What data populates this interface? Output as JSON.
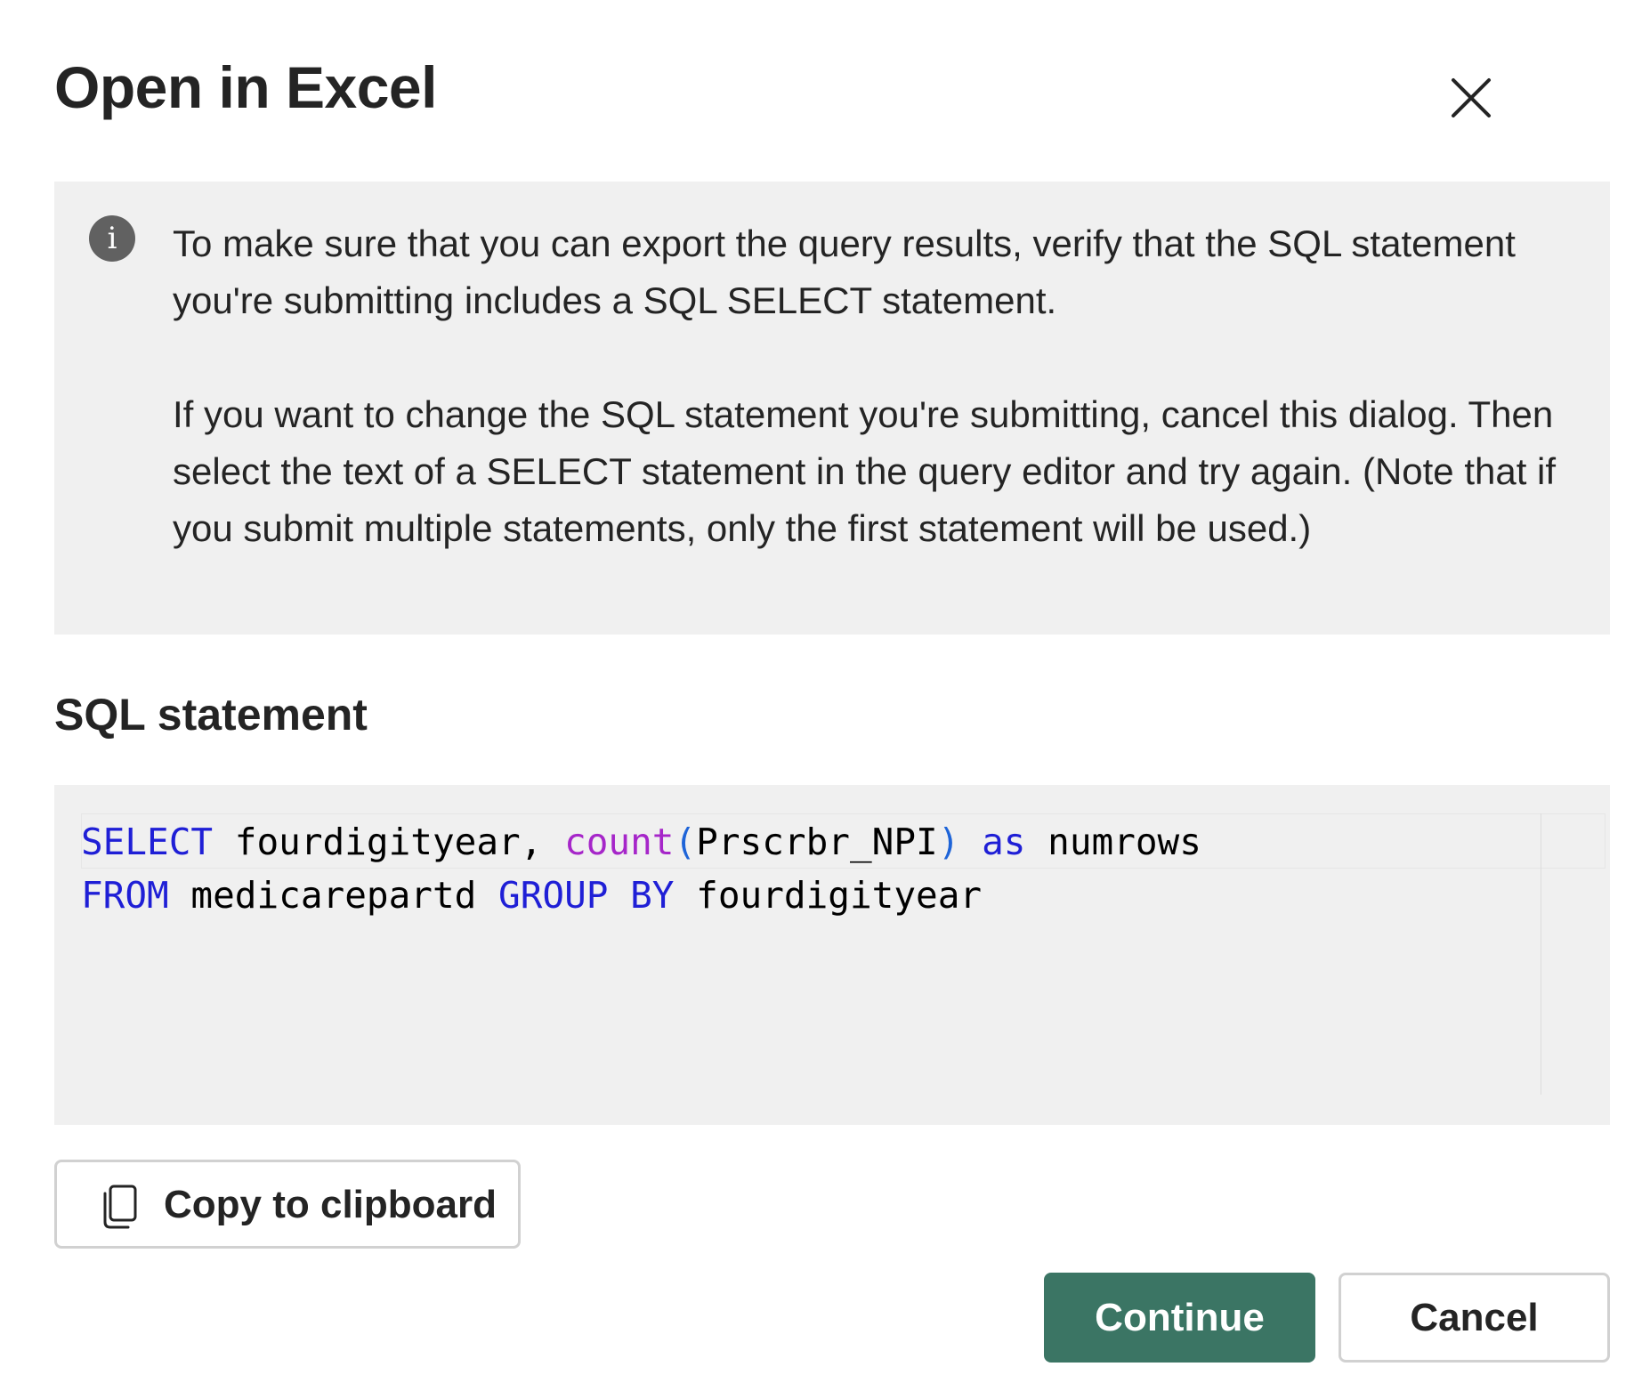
{
  "dialog": {
    "title": "Open in Excel",
    "close_icon": "close-icon"
  },
  "info": {
    "icon": "info-icon",
    "icon_glyph": "i",
    "paragraph1": "To make sure that you can export the query results, verify that the SQL statement you're submitting includes a SQL SELECT statement.",
    "paragraph2": "If you want to change the SQL statement you're submitting, cancel this dialog. Then select the text of a SELECT statement in the query editor and try again. (Note that if you submit multiple statements, only the first statement will be used.)"
  },
  "sql_section": {
    "heading": "SQL statement",
    "code_lines": [
      [
        {
          "text": "SELECT",
          "kind": "kw"
        },
        {
          "text": " fourdigityear, ",
          "kind": "plain"
        },
        {
          "text": "count",
          "kind": "fn"
        },
        {
          "text": "(",
          "kind": "paren"
        },
        {
          "text": "Prscrbr_NPI",
          "kind": "plain"
        },
        {
          "text": ")",
          "kind": "paren"
        },
        {
          "text": " ",
          "kind": "plain"
        },
        {
          "text": "as",
          "kind": "kw"
        },
        {
          "text": " numrows",
          "kind": "plain"
        }
      ],
      [
        {
          "text": "FROM",
          "kind": "kw"
        },
        {
          "text": " medicarepartd ",
          "kind": "plain"
        },
        {
          "text": "GROUP BY",
          "kind": "kw"
        },
        {
          "text": " fourdigityear",
          "kind": "plain"
        }
      ]
    ]
  },
  "buttons": {
    "copy_label": "Copy to clipboard",
    "copy_icon": "copy-icon",
    "continue_label": "Continue",
    "cancel_label": "Cancel"
  },
  "colors": {
    "primary": "#3b7564",
    "keyword": "#1f1fd6",
    "function": "#a626c9",
    "paren": "#1e64d8",
    "panel_bg": "#f0f0f0"
  }
}
